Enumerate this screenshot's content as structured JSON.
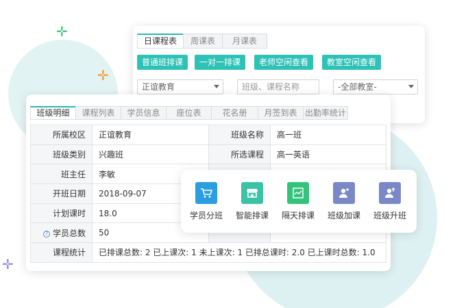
{
  "schedule": {
    "tabs": [
      {
        "label": "日课程表",
        "active": true
      },
      {
        "label": "周课表",
        "active": false
      },
      {
        "label": "月课表",
        "active": false
      }
    ],
    "buttons": {
      "normal_class": "普通班排课",
      "one_on_one": "一对一排课",
      "teacher_free": "老师空闲查看",
      "room_free": "教室空闲查看"
    },
    "filters": {
      "campus_value": "正谊教育",
      "search_placeholder": "班级、课程名称",
      "room_value": "-全部教室-"
    }
  },
  "detail": {
    "tabs": [
      {
        "label": "班级明细",
        "active": true
      },
      {
        "label": "课程列表",
        "active": false
      },
      {
        "label": "学员信息",
        "active": false
      },
      {
        "label": "座位表",
        "active": false
      },
      {
        "label": "花名册",
        "active": false
      },
      {
        "label": "月签到表",
        "active": false
      },
      {
        "label": "出勤率统计",
        "active": false
      }
    ],
    "rows": {
      "campus_label": "所属校区",
      "campus_value": "正谊教育",
      "class_name_label": "班级名称",
      "class_name_value": "高一班",
      "class_type_label": "班级类别",
      "class_type_value": "兴趣班",
      "course_label": "所选课程",
      "course_value": "高一英语",
      "teacher_label": "班主任",
      "teacher_value": "李敏",
      "start_date_label": "开班日期",
      "start_date_value": "2018-09-07",
      "planned_hours_label": "计划课时",
      "planned_hours_value": "18.0",
      "students_label": "学员总数",
      "students_value": "50",
      "stats_label": "课程统计",
      "stats_value": "已排课总数: 2 已上课次: 1 未上课次: 1 已排总课时: 2.0 已上课时总数: 1.0"
    }
  },
  "actions": [
    {
      "label": "学员分班",
      "icon": "cart-icon",
      "color": "#2b9ee1"
    },
    {
      "label": "智能排课",
      "icon": "store-icon",
      "color": "#3cc3a7"
    },
    {
      "label": "隔天排课",
      "icon": "chart-icon",
      "color": "#34c37a"
    },
    {
      "label": "班级加课",
      "icon": "user-plus-icon",
      "color": "#7b88c6"
    },
    {
      "label": "班级升班",
      "icon": "user-up-icon",
      "color": "#7b88c6"
    }
  ]
}
